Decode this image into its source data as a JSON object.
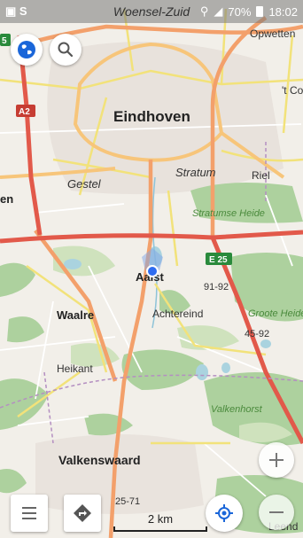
{
  "status_bar": {
    "left_icons": "▣ S",
    "area_name": "Woensel-Zuid",
    "battery": "70%",
    "time": "18:02"
  },
  "map_labels": {
    "opwetten": "Opwetten",
    "tco": "'t Co",
    "eindhoven": "Eindhoven",
    "a2": "A2",
    "gestel": "Gestel",
    "stratum": "Stratum",
    "riel": "Riel",
    "en_fragment": "en",
    "stratumse_heide": "Stratumse Heide",
    "e25": "E 25",
    "aalst": "Aalst",
    "km91": "91-92",
    "groote_heide": "Groote Heide",
    "waalre": "Waalre",
    "achtereind": "Achtereind",
    "km45": "45-92",
    "heikant": "Heikant",
    "valkenhorst": "Valkenhorst",
    "valkenswaard": "Valkenswaard",
    "km25": "25-71",
    "leende": "Leend",
    "route5": "5"
  },
  "controls": {
    "scale_label": "2 km"
  },
  "icons": {
    "globe": "globe-icon",
    "search": "search-icon",
    "menu": "menu-icon",
    "directions": "directions-icon",
    "location": "my-location-icon",
    "zoom_in": "zoom-in-icon",
    "zoom_out": "zoom-out-icon"
  },
  "colors": {
    "map_bg": "#f2efe9",
    "forest": "#add19e",
    "motorway": "#e2594a",
    "trunk": "#f3a06b",
    "primary": "#f7c57a",
    "secondary": "#f2e27a",
    "water": "#aad3df",
    "location_dot": "#2e6cf0",
    "accent_blue": "#1a66d9"
  }
}
